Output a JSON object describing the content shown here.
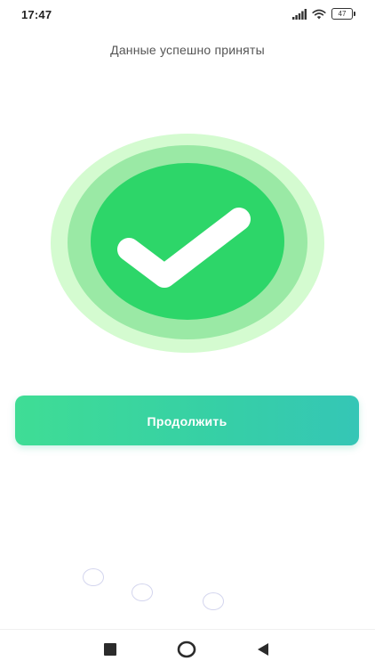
{
  "status_bar": {
    "time": "17:47",
    "battery_level": "47",
    "icons": [
      "signal-icon",
      "wifi-icon",
      "battery-icon"
    ]
  },
  "header": {
    "title": "Данные успешно приняты"
  },
  "success": {
    "icon": "checkmark-icon",
    "colors": {
      "outer_ring": "#d4fbd0",
      "middle_ring": "#9ae9a5",
      "inner_circle": "#2dd669",
      "check": "#ffffff"
    }
  },
  "actions": {
    "continue_label": "Продолжить",
    "button_gradient": [
      "#3fdd95",
      "#35c6b6"
    ]
  },
  "loader": {
    "icon": "loading-dots-icon"
  },
  "navigation_bar": {
    "icons": [
      "recents-square-icon",
      "home-circle-icon",
      "back-triangle-icon"
    ]
  }
}
